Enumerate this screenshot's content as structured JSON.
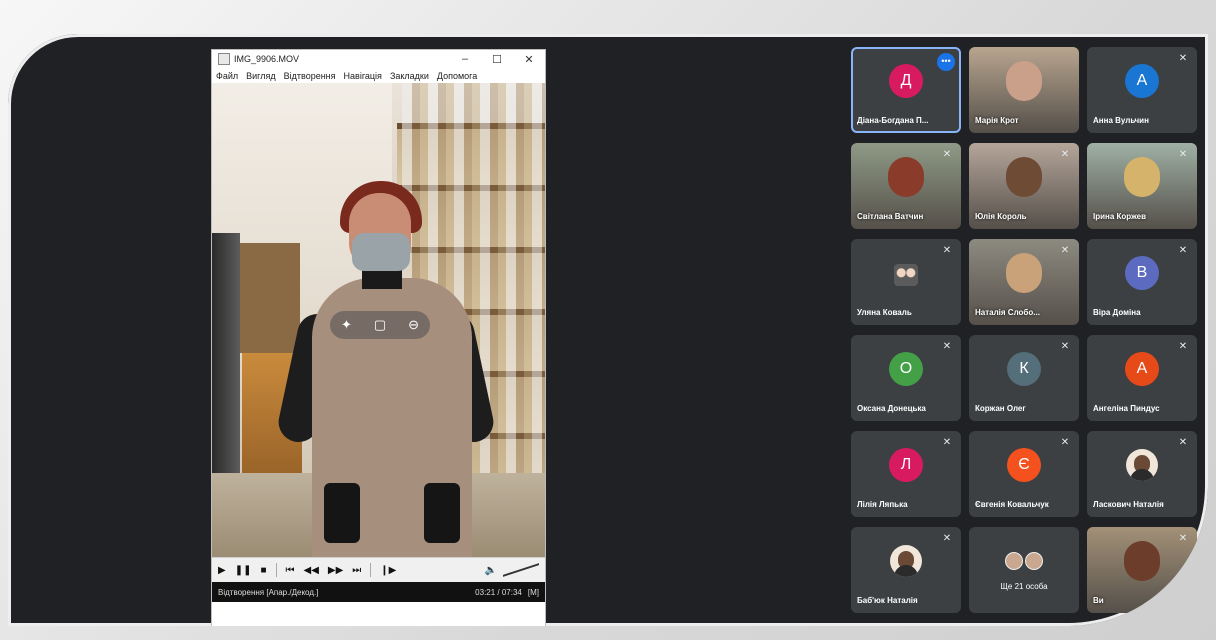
{
  "player": {
    "title": "IMG_9906.MOV",
    "window_buttons": [
      "–",
      "☐",
      "✕"
    ],
    "menu": [
      "Файл",
      "Вигляд",
      "Відтворення",
      "Навігація",
      "Закладки",
      "Допомога"
    ],
    "status_text": "Відтворення [Апар./Декод.]",
    "time": "03:21 / 07:34",
    "time_badge": "[M]"
  },
  "participants": [
    {
      "name": "Діана-Богдана П...",
      "initial": "Д",
      "color": "#d81b60",
      "type": "avatar",
      "active": true,
      "muted": false
    },
    {
      "name": "Марія Крот",
      "type": "photo",
      "bg": "#b8a58f",
      "face": "#caa08b"
    },
    {
      "name": "Анна Вульчин",
      "initial": "А",
      "color": "#1976d2",
      "type": "avatar",
      "muted": true
    },
    {
      "name": "Світлана Ватчин",
      "type": "photo",
      "bg": "#8f9a86",
      "face": "#8a3b2a",
      "muted": true
    },
    {
      "name": "Юлія Король",
      "type": "photo",
      "bg": "#b5a69a",
      "face": "#6d4b34",
      "muted": true
    },
    {
      "name": "Ірина Коржев",
      "type": "photo",
      "bg": "#9fb0a4",
      "face": "#d6b36a",
      "muted": true
    },
    {
      "name": "Уляна Коваль",
      "type": "kids",
      "muted": true
    },
    {
      "name": "Наталія Слобо...",
      "type": "photo",
      "bg": "#8d8a80",
      "face": "#c9a27a",
      "muted": true
    },
    {
      "name": "Віра Доміна",
      "initial": "В",
      "color": "#5c6bc0",
      "type": "avatar",
      "muted": true
    },
    {
      "name": "Оксана Донецька",
      "initial": "О",
      "color": "#43a047",
      "type": "avatar",
      "muted": true
    },
    {
      "name": "Коржан Олег",
      "initial": "К",
      "color": "#546e7a",
      "type": "avatar",
      "muted": true
    },
    {
      "name": "Ангеліна Пиндус",
      "initial": "А",
      "color": "#e64a19",
      "type": "avatar",
      "muted": true
    },
    {
      "name": "Лілія Ляпька",
      "initial": "Л",
      "color": "#d81b60",
      "type": "avatar",
      "muted": true
    },
    {
      "name": "Євгенія Ковальчук",
      "initial": "Є",
      "color": "#f4511e",
      "type": "avatar",
      "muted": true
    },
    {
      "name": "Ласкович Наталія",
      "type": "smallphoto",
      "muted": true
    },
    {
      "name": "Баб'юк Наталія",
      "type": "smallphoto",
      "muted": true
    },
    {
      "name": "Ще 21 особа",
      "type": "more"
    },
    {
      "name": "Ви",
      "type": "photo",
      "bg": "#a39178",
      "face": "#6b3d2a",
      "muted": true
    }
  ],
  "icons": {
    "mic_off": "mic-off-icon",
    "more": "more-options-icon"
  }
}
